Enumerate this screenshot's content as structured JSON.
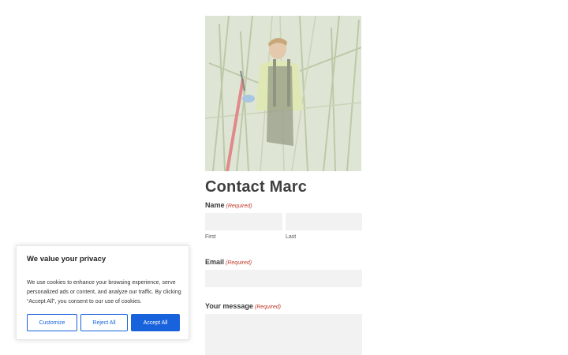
{
  "contact": {
    "title": "Contact Marc",
    "photo_alt": "Marc in tall reeds",
    "name_label": "Name",
    "required_text": "(Required)",
    "first_label": "First",
    "last_label": "Last",
    "first_value": "",
    "last_value": "",
    "email_label": "Email",
    "email_value": "",
    "message_label": "Your message",
    "message_value": ""
  },
  "cookie_banner": {
    "title": "We value your privacy",
    "body": "We use cookies to enhance your browsing experience, serve personalized ads or content, and analyze our traffic. By clicking “Accept All”, you consent to our use of cookies.",
    "customize_label": "Customize",
    "reject_label": "Reject All",
    "accept_label": "Accept All"
  },
  "colors": {
    "accent": "#1863dc",
    "required": "#c0392b",
    "field_bg": "#f2f2f2"
  }
}
